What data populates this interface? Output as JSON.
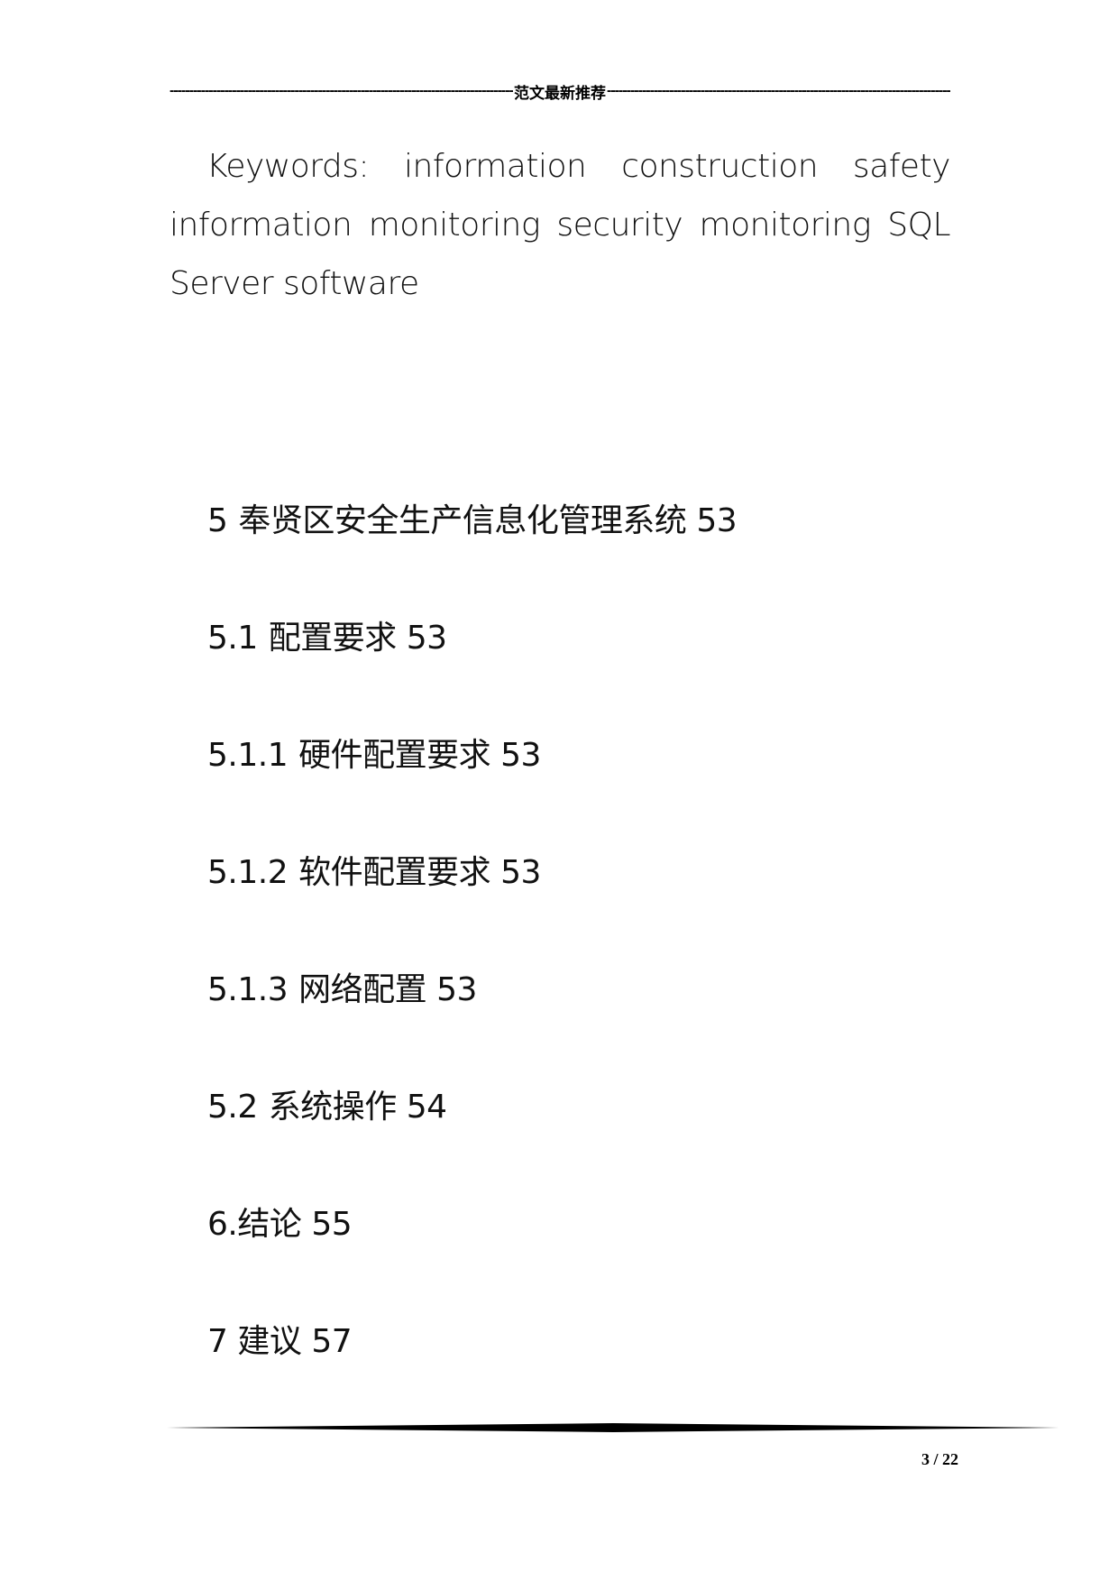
{
  "header": {
    "title": "范文最新推荐",
    "left_dashes": "------------------------------------------------------------------------------------------------",
    "right_dashes": "------------------------------------------------------------------------------------------"
  },
  "keywords": {
    "text": "Keywords: information construction safety information monitoring security monitoring SQL Server software"
  },
  "toc": {
    "items": [
      {
        "number": "5",
        "title": "奉贤区安全生产信息化管理系统",
        "page": "53"
      },
      {
        "number": "5.1",
        "title": "配置要求",
        "page": "53"
      },
      {
        "number": "5.1.1",
        "title": "硬件配置要求",
        "page": "53"
      },
      {
        "number": "5.1.2",
        "title": "软件配置要求",
        "page": "53"
      },
      {
        "number": "5.1.3",
        "title": "网络配置",
        "page": "53"
      },
      {
        "number": "5.2",
        "title": "系统操作",
        "page": "54"
      },
      {
        "number": "6.",
        "title": "结论",
        "page": "55"
      },
      {
        "number": "7",
        "title": "建议",
        "page": "57"
      }
    ]
  },
  "footer": {
    "page_current": "3",
    "page_total": "22",
    "page_label": "3 / 22"
  }
}
